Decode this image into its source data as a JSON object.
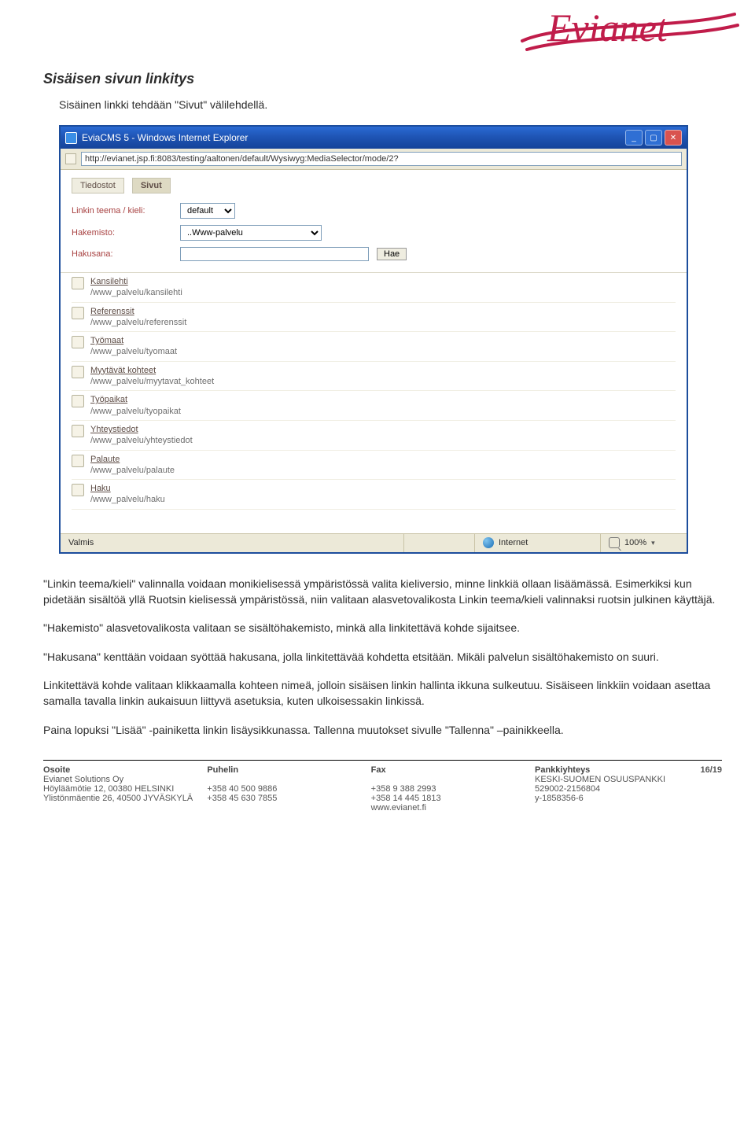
{
  "logo": {
    "name": "Evianet"
  },
  "heading": "Sisäisen sivun linkitys",
  "intro": "Sisäinen linkki tehdään \"Sivut\" välilehdellä.",
  "window": {
    "title": "EviaCMS 5 - Windows Internet Explorer",
    "url": "http://evianet.jsp.fi:8083/testing/aaltonen/default/Wysiwyg:MediaSelector/mode/2?",
    "tabs": {
      "files": "Tiedostot",
      "pages": "Sivut"
    },
    "form": {
      "theme_label": "Linkin teema / kieli:",
      "theme_value": "default",
      "dir_label": "Hakemisto:",
      "dir_value": "..Www-palvelu",
      "search_label": "Hakusana:",
      "search_button": "Hae"
    },
    "items": [
      {
        "title": "Kansilehti",
        "path": "/www_palvelu/kansilehti"
      },
      {
        "title": "Referenssit",
        "path": "/www_palvelu/referenssit"
      },
      {
        "title": "Työmaat",
        "path": "/www_palvelu/tyomaat"
      },
      {
        "title": "Myytävät kohteet",
        "path": "/www_palvelu/myytavat_kohteet"
      },
      {
        "title": "Työpaikat",
        "path": "/www_palvelu/tyopaikat"
      },
      {
        "title": "Yhteystiedot",
        "path": "/www_palvelu/yhteystiedot"
      },
      {
        "title": "Palaute",
        "path": "/www_palvelu/palaute"
      },
      {
        "title": "Haku",
        "path": "/www_palvelu/haku"
      }
    ],
    "status": {
      "done": "Valmis",
      "zone": "Internet",
      "zoom": "100%"
    }
  },
  "body": {
    "p1": "\"Linkin teema/kieli\" valinnalla voidaan monikielisessä ympäristössä valita kieliversio, minne linkkiä ollaan lisäämässä. Esimerkiksi kun pidetään sisältöä yllä Ruotsin kielisessä ympäristössä, niin valitaan alasvetovalikosta Linkin teema/kieli valinnaksi ruotsin julkinen käyttäjä.",
    "p2": "\"Hakemisto\" alasvetovalikosta valitaan se sisältöhakemisto, minkä alla linkitettävä kohde sijaitsee.",
    "p3": "\"Hakusana\" kenttään voidaan syöttää hakusana, jolla linkitettävää kohdetta etsitään. Mikäli palvelun sisältöhakemisto on suuri.",
    "p4": "Linkitettävä kohde valitaan klikkaamalla kohteen nimeä, jolloin sisäisen linkin hallinta ikkuna sulkeutuu. Sisäiseen linkkiin voidaan asettaa samalla tavalla linkin aukaisuun liittyvä asetuksia, kuten ulkoisessakin linkissä.",
    "p5": "Paina lopuksi \"Lisää\" -painiketta linkin lisäysikkunassa. Tallenna muutokset sivulle \"Tallenna\" –painikkeella."
  },
  "footer": {
    "address_head": "Osoite",
    "address_l1": "Evianet Solutions Oy",
    "address_l2": "Höyläämötie 12, 00380 HELSINKI",
    "address_l3": "Ylistönmäentie 26, 40500 JYVÄSKYLÄ",
    "phone_head": "Puhelin",
    "phone_l2": "+358 40 500 9886",
    "phone_l3": "+358 45 630 7855",
    "fax_head": "Fax",
    "fax_l2": "+358 9 388 2993",
    "fax_l3": "+358 14 445 1813",
    "fax_l4": "www.evianet.fi",
    "bank_head": "Pankkiyhteys",
    "page": "16/19",
    "bank_l1": "KESKI-SUOMEN OSUUSPANKKI",
    "bank_l2": "529002-2156804",
    "bank_l3": "y-1858356-6"
  }
}
